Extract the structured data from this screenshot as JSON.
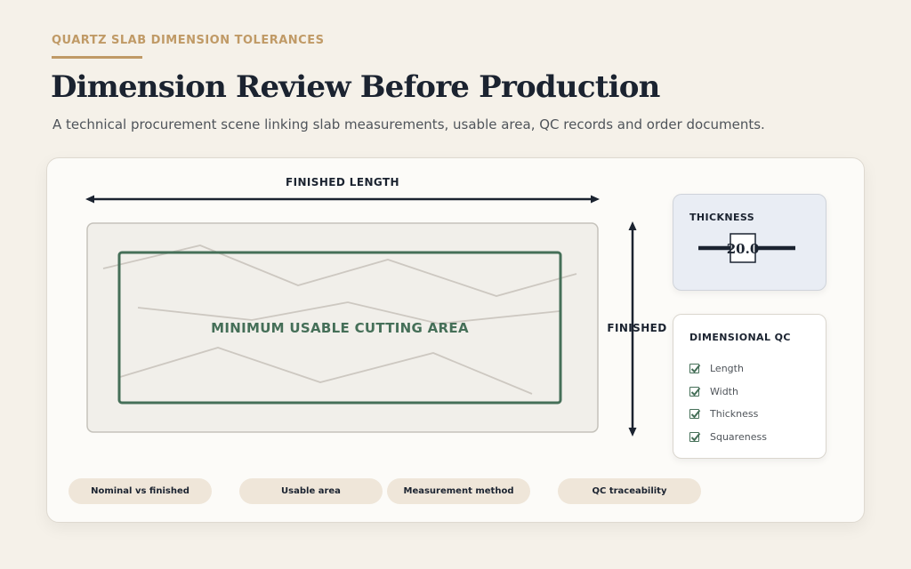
{
  "eyebrow": "QUARTZ SLAB DIMENSION TOLERANCES",
  "headline": "Dimension Review Before Production",
  "subline": "A technical procurement scene linking slab measurements, usable area, QC records and order documents.",
  "diagram": {
    "length_label": "FINISHED LENGTH",
    "width_label": "FINISHED",
    "usable_area_label": "MINIMUM USABLE CUTTING AREA"
  },
  "thickness": {
    "title": "THICKNESS",
    "value": "20.0"
  },
  "qc": {
    "title": "DIMENSIONAL QC",
    "items": [
      "Length",
      "Width",
      "Thickness",
      "Squareness"
    ]
  },
  "chips": [
    "Nominal vs finished",
    "Usable area",
    "Measurement method",
    "QC traceability"
  ],
  "colors": {
    "accent_gold": "#c09a66",
    "usable_green": "#456f58",
    "ink": "#1b2330",
    "chip_bg": "#efe6d9"
  }
}
